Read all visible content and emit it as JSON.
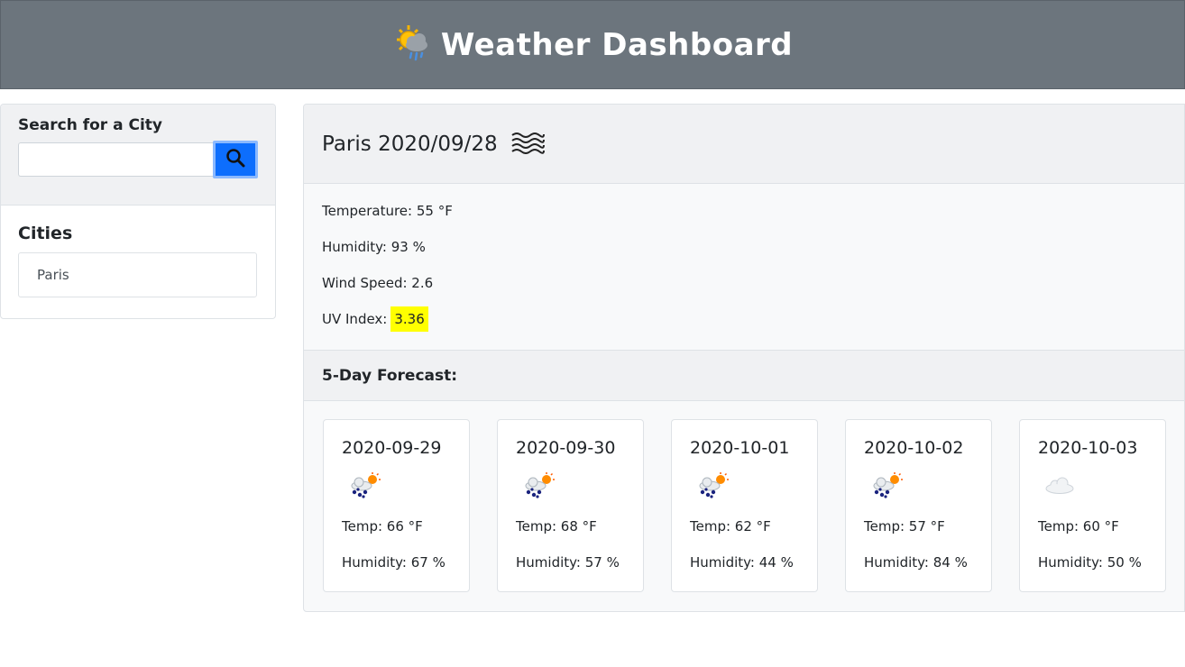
{
  "header": {
    "title": "Weather Dashboard",
    "icon": "sun-cloud-rain-icon"
  },
  "search": {
    "label": "Search for a City",
    "value": "",
    "placeholder": ""
  },
  "cities": {
    "title": "Cities",
    "items": [
      "Paris"
    ]
  },
  "current": {
    "title": "Paris 2020/09/28",
    "icon": "mist-icon",
    "temperature": "Temperature: 55 °F",
    "humidity": "Humidity: 93 %",
    "wind": "Wind Speed: 2.6",
    "uv_label": "UV Index:",
    "uv_value": "3.36",
    "uv_color": "#ffff00"
  },
  "forecast": {
    "title": "5-Day Forecast:",
    "days": [
      {
        "date": "2020-09-29",
        "icon": "rain-sun-icon",
        "temp": "Temp: 66 °F",
        "humidity": "Humidity: 67 %"
      },
      {
        "date": "2020-09-30",
        "icon": "rain-sun-icon",
        "temp": "Temp: 68 °F",
        "humidity": "Humidity: 57 %"
      },
      {
        "date": "2020-10-01",
        "icon": "rain-sun-icon",
        "temp": "Temp: 62 °F",
        "humidity": "Humidity: 44 %"
      },
      {
        "date": "2020-10-02",
        "icon": "rain-sun-icon",
        "temp": "Temp: 57 °F",
        "humidity": "Humidity: 84 %"
      },
      {
        "date": "2020-10-03",
        "icon": "cloud-icon",
        "temp": "Temp: 60 °F",
        "humidity": "Humidity: 50 %"
      }
    ]
  },
  "colors": {
    "header_bg": "#6c757d",
    "search_button": "#0d6efd"
  }
}
